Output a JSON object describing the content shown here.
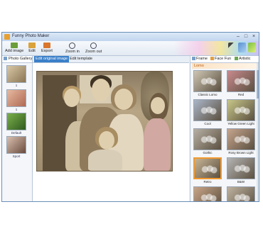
{
  "window": {
    "title": "Funny Photo Maker"
  },
  "toolbar": {
    "items": [
      {
        "label": "Add image",
        "icon": "add-image-icon"
      },
      {
        "label": "Edit",
        "icon": "edit-icon"
      },
      {
        "label": "Export",
        "icon": "export-icon"
      },
      {
        "label": "Zoom in",
        "icon": "zoom-in-icon"
      },
      {
        "label": "Zoom out",
        "icon": "zoom-out-icon"
      }
    ]
  },
  "left_panel": {
    "tab_label": "Photo Gallery",
    "thumbnails": [
      {
        "caption": "1"
      },
      {
        "caption": "1"
      },
      {
        "caption": "Default"
      },
      {
        "caption": "Sport"
      }
    ]
  },
  "center": {
    "tabs": [
      {
        "label": "Edit original image",
        "active": true
      },
      {
        "label": "Edit template",
        "active": false
      }
    ]
  },
  "right_panel": {
    "tabs": [
      {
        "label": "Frame",
        "icon": "frame-icon"
      },
      {
        "label": "Face Fun",
        "icon": "face-fun-icon"
      },
      {
        "label": "Artistic",
        "icon": "artistic-icon"
      }
    ],
    "category": "Lomo",
    "effects": [
      {
        "name": "Classic Lomo",
        "tint": "#cfc6b4",
        "selected": false
      },
      {
        "name": "Red",
        "tint": "#c98a8e",
        "selected": false
      },
      {
        "name": "Cool",
        "tint": "#aab6c8",
        "selected": false
      },
      {
        "name": "Yellow Green Light",
        "tint": "#c8c78a",
        "selected": false
      },
      {
        "name": "Gothic",
        "tint": "#b7b0a5",
        "selected": false
      },
      {
        "name": "Rosy Brown Light",
        "tint": "#c6a58e",
        "selected": false
      },
      {
        "name": "Retro",
        "tint": "#c7b495",
        "selected": true
      },
      {
        "name": "B&W",
        "tint": "#b5b5b5",
        "selected": false
      },
      {
        "name": "",
        "tint": "#c9a588",
        "selected": false
      },
      {
        "name": "",
        "tint": "#bfb3a0",
        "selected": false
      }
    ]
  },
  "colors": {
    "accent": "#3a7fc9",
    "selection": "#f1992e",
    "category_text": "#b55a10"
  }
}
